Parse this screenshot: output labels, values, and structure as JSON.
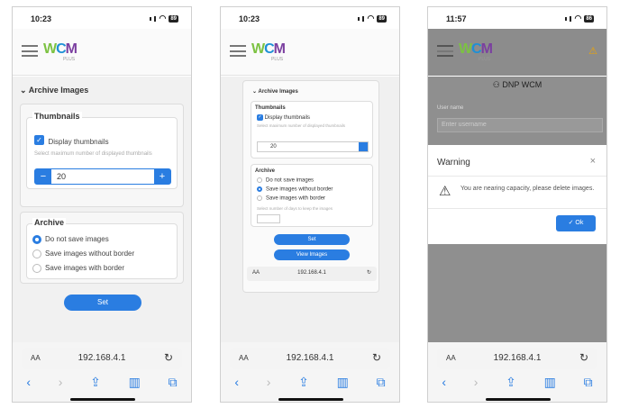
{
  "screen1": {
    "time": "10:23",
    "battery": "89",
    "section_title": "Archive Images",
    "thumbnails_legend": "Thumbnails",
    "display_thumbnails": "Display thumbnails",
    "max_hint": "Select maximum number of displayed thumbnails",
    "thumb_value": "20",
    "minus": "−",
    "plus": "+",
    "archive_legend": "Archive",
    "options": [
      "Do not save images",
      "Save images without border",
      "Save images with border"
    ],
    "selected_option": 0,
    "set_label": "Set",
    "url": "192.168.4.1",
    "aa": "AA"
  },
  "screen2": {
    "time": "10:23",
    "battery": "89",
    "section_title": "Archive Images",
    "thumbnails_legend": "Thumbnails",
    "display_thumbnails": "Display thumbnails",
    "max_hint": "Select maximum number of displayed thumbnails",
    "thumb_value": "20",
    "archive_legend": "Archive",
    "options": [
      "Do not save images",
      "Save images without border",
      "Save images with border"
    ],
    "selected_option": 1,
    "days_hint": "Select number of days to keep the images",
    "set_label": "Set",
    "view_label": "View Images",
    "inner_url": "192.168.4.1",
    "url": "192.168.4.1",
    "aa": "AA"
  },
  "screen3": {
    "time": "11:57",
    "battery": "86",
    "device_name": "DNP WCM",
    "username_label": "User name",
    "username_placeholder": "Enter username",
    "warning_title": "Warning",
    "warning_message": "You are nearing capacity, please delete images.",
    "ok_label": "✓ Ok",
    "url": "192.168.4.1",
    "aa": "AA"
  },
  "logo": {
    "w": "W",
    "c": "C",
    "m": "M",
    "plus": "PLUS"
  },
  "colors": {
    "accent": "#2a7de1",
    "logo_w": "#7cc242",
    "logo_c": "#1e90d6",
    "logo_m": "#7b3fa0",
    "warning_icon": "#f0a500"
  },
  "icons": [
    "hamburger-icon",
    "chevron-down-icon",
    "person-icon",
    "warning-icon",
    "close-icon",
    "share-icon",
    "bookmarks-icon",
    "tabs-icon",
    "reload-icon",
    "back-icon",
    "forward-icon"
  ]
}
